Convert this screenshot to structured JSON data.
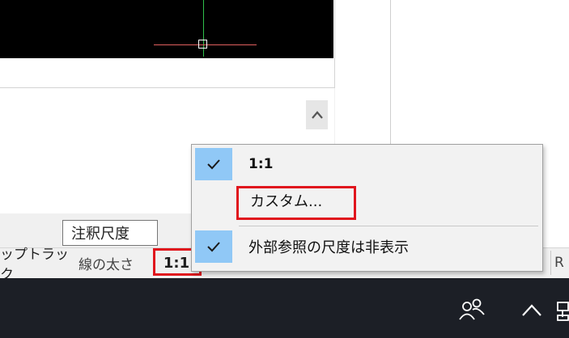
{
  "tooltip": {
    "text": "注釈尺度"
  },
  "status_bar": {
    "snap_track_label": "ップトラック",
    "lineweight_label": "線の太さ",
    "annotation_scale_value": "1:1",
    "partial_label": "R"
  },
  "context_menu": {
    "items": [
      {
        "label": "1:1",
        "checked": true
      },
      {
        "label": "カスタム...",
        "checked": false
      },
      {
        "label": "外部参照の尺度は非表示",
        "checked": true
      }
    ]
  },
  "colors": {
    "highlight_red": "#e0151d",
    "check_bg": "#90c8f6",
    "taskbar": "#1c1f26",
    "viewport": "#000000"
  }
}
